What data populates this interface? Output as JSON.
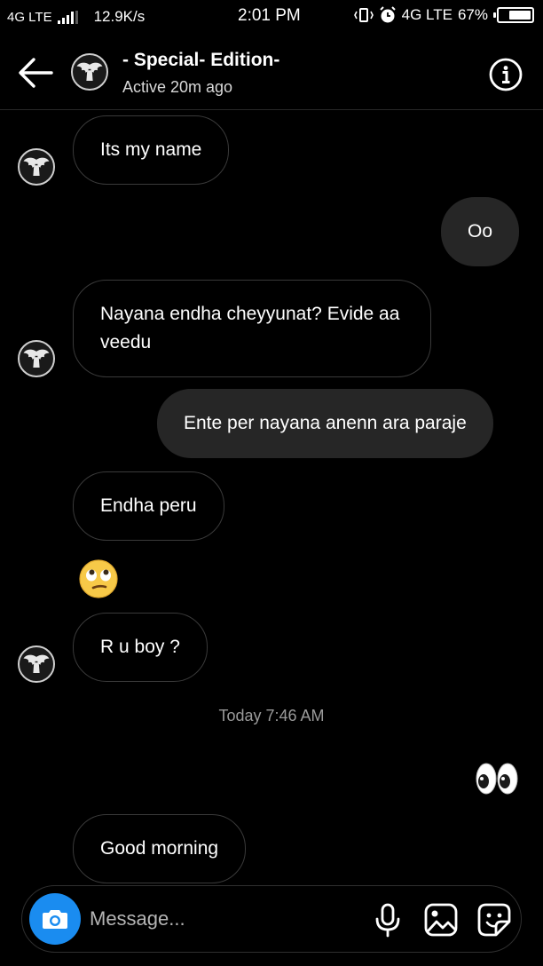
{
  "status_bar": {
    "network": "4G LTE",
    "speed": "12.9K/s",
    "time": "2:01 PM",
    "network_right": "4G LTE",
    "battery_percent": 67,
    "battery_label": "67%"
  },
  "header": {
    "title": "- Special- Edition-",
    "subtitle": "Active 20m ago"
  },
  "messages": [
    {
      "dir": "in",
      "text": "Its my name"
    },
    {
      "dir": "out",
      "text": "Oo"
    },
    {
      "dir": "in",
      "text": "Nayana endha cheyyunat? Evide aa veedu"
    },
    {
      "dir": "out",
      "text": "Ente per nayana anenn ara paraje"
    },
    {
      "dir": "in",
      "text": "Endha peru"
    },
    {
      "dir": "in",
      "emoji": "face-with-rolling-eyes-icon"
    },
    {
      "dir": "in",
      "text": "R u boy ?"
    },
    {
      "dir": "out",
      "emoji": "eyes-icon"
    },
    {
      "dir": "in",
      "text": "Good morning"
    }
  ],
  "timestamp": "Today 7:46 AM",
  "composer": {
    "placeholder": "Message...",
    "accent": "#1a8cf0"
  },
  "colors": {
    "background": "#000000",
    "outgoing_bubble": "#262626",
    "incoming_border": "#3a3a3a"
  }
}
